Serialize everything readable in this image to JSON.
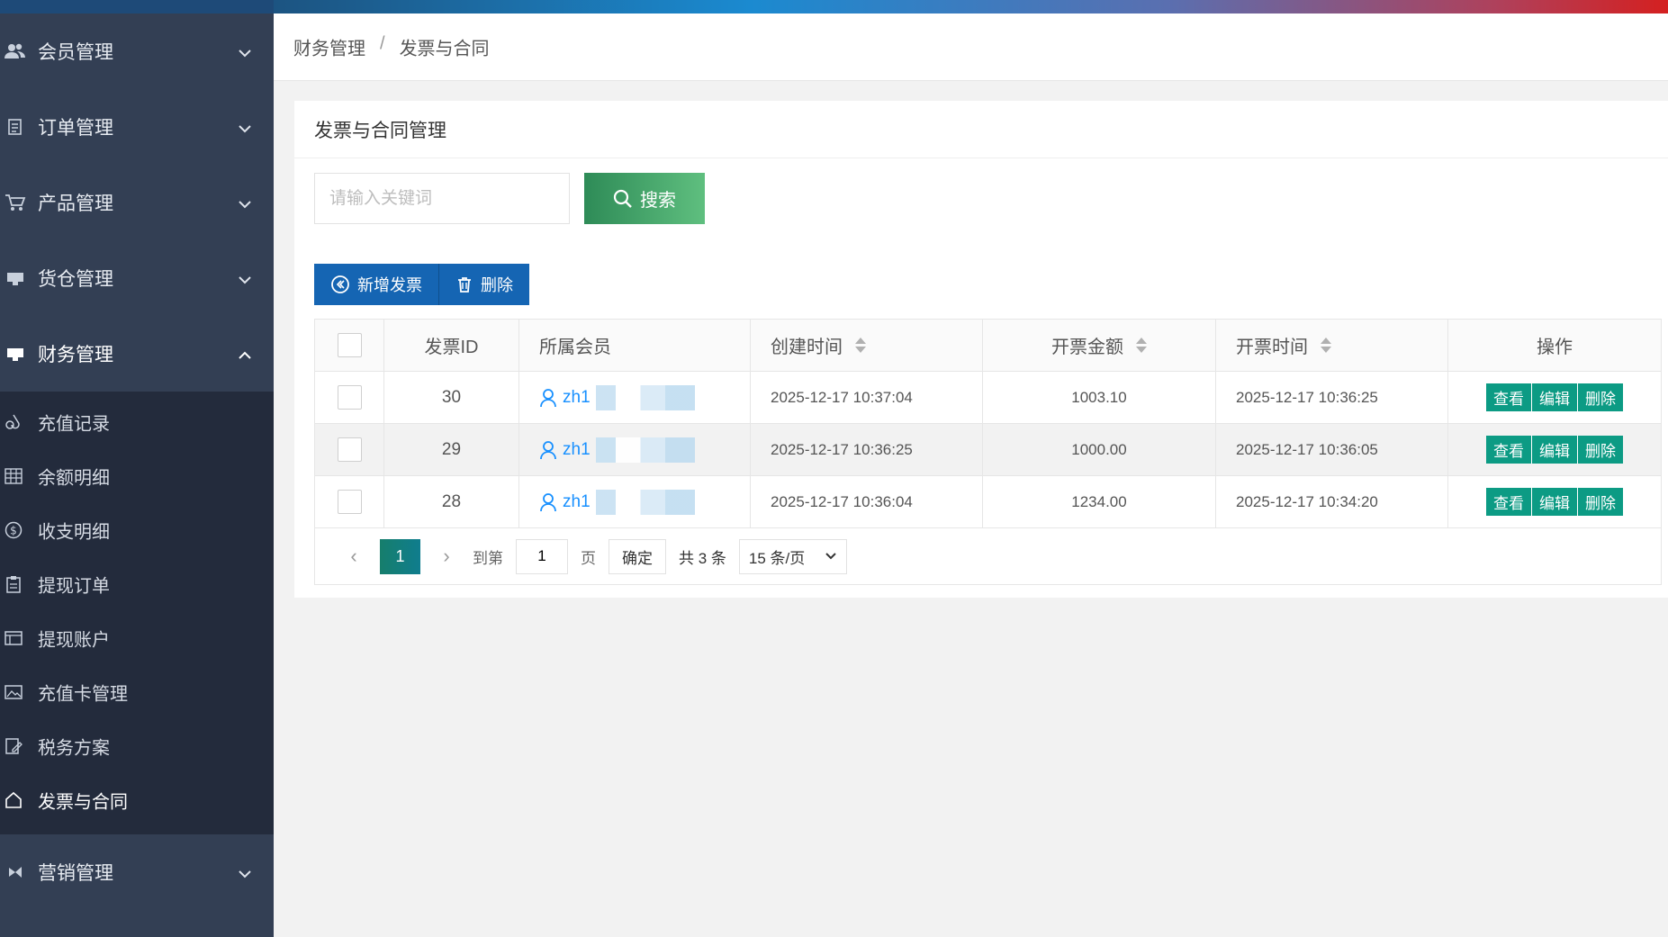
{
  "sidebar": {
    "groups_top": [
      {
        "label": "会员管理",
        "icon": "users-icon"
      },
      {
        "label": "订单管理",
        "icon": "document-icon"
      },
      {
        "label": "产品管理",
        "icon": "cart-icon"
      },
      {
        "label": "货仓管理",
        "icon": "warehouse-icon"
      }
    ],
    "active_group": {
      "label": "财务管理",
      "icon": "finance-icon"
    },
    "sub_items": [
      {
        "label": "充值记录",
        "icon": "droplet-icon"
      },
      {
        "label": "余额明细",
        "icon": "grid-icon"
      },
      {
        "label": "收支明细",
        "icon": "dollar-icon"
      },
      {
        "label": "提现订单",
        "icon": "clipboard-icon"
      },
      {
        "label": "提现账户",
        "icon": "card-icon"
      },
      {
        "label": "充值卡管理",
        "icon": "image-icon"
      },
      {
        "label": "税务方案",
        "icon": "edit-doc-icon"
      },
      {
        "label": "发票与合同",
        "icon": "home-icon"
      }
    ],
    "groups_bottom": [
      {
        "label": "营销管理",
        "icon": "megaphone-icon"
      }
    ]
  },
  "breadcrumb": {
    "parent": "财务管理",
    "separator": "/",
    "current": "发票与合同"
  },
  "card": {
    "title": "发票与合同管理",
    "search": {
      "placeholder": "请输入关键词",
      "button": "搜索"
    },
    "toolbar": {
      "add": "新增发票",
      "delete": "删除"
    }
  },
  "table": {
    "headers": {
      "id": "发票ID",
      "member": "所属会员",
      "created": "创建时间",
      "amount": "开票金额",
      "invoice_time": "开票时间",
      "ops": "操作"
    },
    "rows": [
      {
        "id": "30",
        "member": "zh1",
        "created": "2025-12-17 10:37:04",
        "amount": "1003.10",
        "invoice_time": "2025-12-17 10:36:25"
      },
      {
        "id": "29",
        "member": "zh1",
        "created": "2025-12-17 10:36:25",
        "amount": "1000.00",
        "invoice_time": "2025-12-17 10:36:05"
      },
      {
        "id": "28",
        "member": "zh1",
        "created": "2025-12-17 10:36:04",
        "amount": "1234.00",
        "invoice_time": "2025-12-17 10:34:20"
      }
    ],
    "row_actions": {
      "view": "查看",
      "edit": "编辑",
      "delete": "删除"
    }
  },
  "pager": {
    "current_page": "1",
    "goto_label": "到第",
    "goto_value": "1",
    "page_unit": "页",
    "confirm": "确定",
    "total": "共 3 条",
    "page_size": "15 条/页"
  },
  "colors": {
    "sidebar_bg": "#333f54",
    "submenu_bg": "#232b3c",
    "primary_blue": "#1565b3",
    "search_green": "#2e8b57",
    "action_teal": "#0c9b84",
    "link_blue": "#1890ff"
  }
}
